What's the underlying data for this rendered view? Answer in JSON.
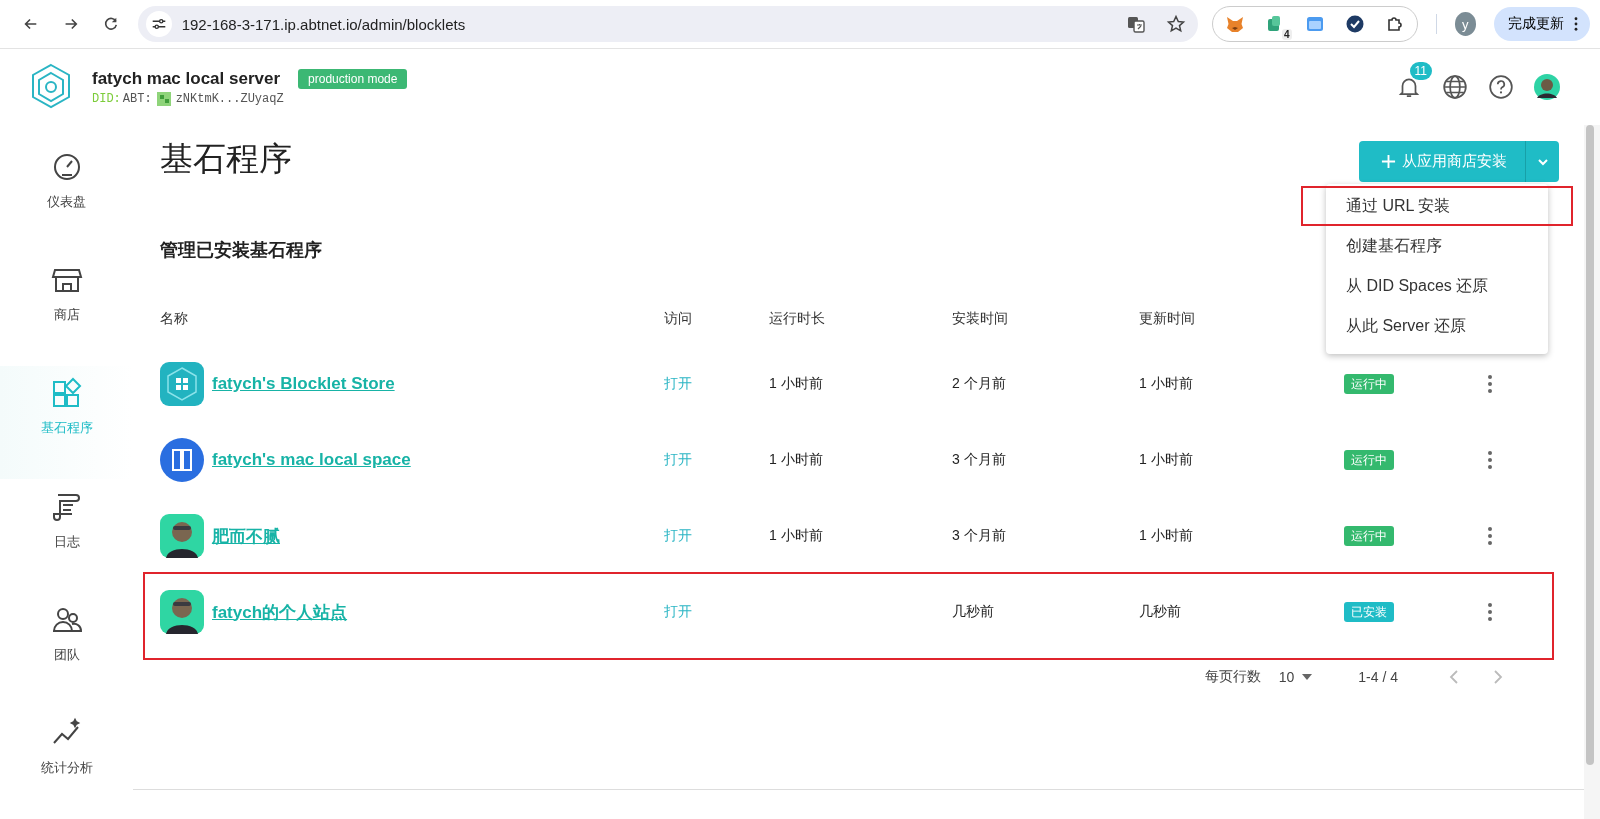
{
  "browser": {
    "url": "192-168-3-171.ip.abtnet.io/admin/blocklets",
    "extension_badge": "4",
    "profile_initial": "y",
    "update_button": "完成更新"
  },
  "header": {
    "title": "fatych mac local server",
    "did_prefix": "DID:",
    "did_type": "ABT:",
    "did_value": "zNKtmK...ZUyaqZ",
    "mode_badge": "production mode",
    "notification_count": "11"
  },
  "sidebar": {
    "items": [
      {
        "label": "仪表盘",
        "kind": "gauge",
        "selected": false
      },
      {
        "label": "商店",
        "kind": "store",
        "selected": false
      },
      {
        "label": "基石程序",
        "kind": "blocks",
        "selected": true
      },
      {
        "label": "日志",
        "kind": "scroll",
        "selected": false
      },
      {
        "label": "团队",
        "kind": "team",
        "selected": false
      },
      {
        "label": "统计分析",
        "kind": "chart",
        "selected": false
      }
    ]
  },
  "page": {
    "title": "基石程序",
    "subtitle": "管理已安装基石程序",
    "install_button": "从应用商店安装",
    "menu": [
      {
        "label": "通过 URL 安装",
        "highlighted": true
      },
      {
        "label": "创建基石程序",
        "highlighted": false
      },
      {
        "label": "从 DID Spaces 还原",
        "highlighted": false
      },
      {
        "label": "从此 Server 还原",
        "highlighted": false
      }
    ]
  },
  "table": {
    "columns": [
      "名称",
      "访问",
      "运行时长",
      "安装时间",
      "更新时间"
    ],
    "rows": [
      {
        "kind": "store",
        "name": "fatych's Blocklet Store",
        "access": "打开",
        "uptime": "1 小时前",
        "installed": "2 个月前",
        "updated": "1 小时前",
        "status": "运行中",
        "color": "#34b96e",
        "highlighted": false
      },
      {
        "kind": "space",
        "name": "fatych's mac local space",
        "access": "打开",
        "uptime": "1 小时前",
        "installed": "3 个月前",
        "updated": "1 小时前",
        "status": "运行中",
        "color": "#34b96e",
        "highlighted": false
      },
      {
        "kind": "avatar",
        "name": "肥而不腻",
        "access": "打开",
        "uptime": "1 小时前",
        "installed": "3 个月前",
        "updated": "1 小时前",
        "status": "运行中",
        "color": "#34b96e",
        "highlighted": false
      },
      {
        "kind": "avatar",
        "name": "fatych的个人站点",
        "access": "打开",
        "installed": "几秒前",
        "updated": "几秒前",
        "status": "已安装",
        "color": "#1fbcc6",
        "highlighted": true
      }
    ]
  },
  "pagination": {
    "rows_label": "每页行数",
    "rows_per_page": "10",
    "range": "1-4 / 4"
  }
}
